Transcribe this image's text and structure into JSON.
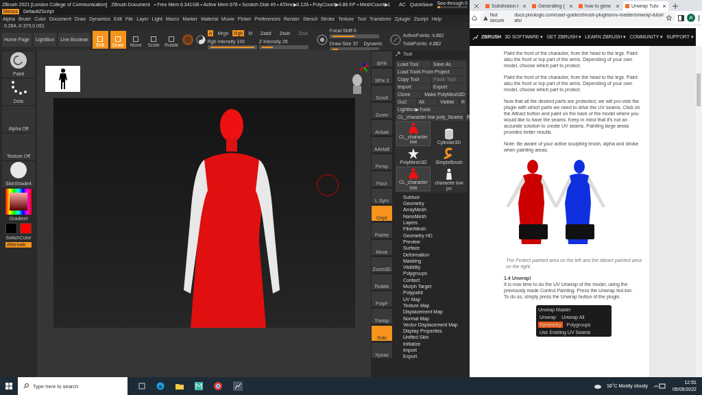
{
  "zbrush": {
    "title_bar": {
      "app": "ZBrush 2021 [London College of Communication]",
      "document": "ZBrush Document",
      "stats": "• Free Mem 6.341GB • Active Mem 676 • Scratch Disk 49 • ATime▶0.126 • PolyCount▶4.86 KP • MeshCount▶1",
      "ac": "AC",
      "quicksave": "QuickSave",
      "see_through": {
        "label": "See-through 0",
        "level": 0
      },
      "menus": {
        "label": "Menus",
        "on": true
      },
      "script": "DefaultZScript"
    },
    "menu": [
      "Alpha",
      "Brush",
      "Color",
      "Document",
      "Draw",
      "Dynamics",
      "Edit",
      "File",
      "Layer",
      "Light",
      "Macro",
      "Marker",
      "Material",
      "Movie",
      "Picker",
      "Preferences",
      "Render",
      "Stencil",
      "Stroke",
      "Texture",
      "Tool",
      "Transform",
      "Zplugin",
      "Zscript",
      "Help"
    ],
    "coordinates": "0.284,-0.379,0.051",
    "toolbar": {
      "buttons": [
        "Home Page",
        "LightBox",
        "Live Boolean"
      ],
      "modes": [
        {
          "label": "Edit",
          "selected": true
        },
        {
          "label": "Draw",
          "selected": true
        },
        {
          "label": "Move",
          "selected": false
        },
        {
          "label": "Scale",
          "selected": false
        },
        {
          "label": "Rotate",
          "selected": false
        }
      ],
      "channels": [
        {
          "label": "A",
          "selected": true
        },
        {
          "label": "Mrgb",
          "selected": false
        },
        {
          "label": "Rgb",
          "selected": true
        },
        {
          "label": "M",
          "selected": false
        }
      ],
      "sculpt": [
        {
          "label": "Zadd",
          "disabled": false
        },
        {
          "label": "Zsub",
          "disabled": false
        },
        {
          "label": "Zcut",
          "disabled": true
        }
      ],
      "sliders": [
        {
          "label": "Rgb Intensity 100",
          "level": 1.0
        },
        {
          "label": "Z Intensity 25",
          "level": 0.25
        },
        {
          "label": "Focal Shift 0",
          "level": 0.5
        },
        {
          "label": "Draw Size 37",
          "level": 0.12
        }
      ],
      "dynamic": "Dynamic",
      "points": [
        "ActivePoints: 4,882",
        "TotalPoints: 4,882"
      ]
    },
    "left_shelf": [
      {
        "label": "Paint",
        "kind": "brush"
      },
      {
        "label": "Dots",
        "kind": "stroke"
      },
      {
        "label": "Alpha Off",
        "kind": "empty"
      },
      {
        "label": "Texture Off",
        "kind": "empty"
      },
      {
        "label": "SkinShade4",
        "kind": "material"
      }
    ],
    "gradient": "Gradient",
    "switch_color": "SwitchColor",
    "alternate": {
      "label": "Alternate",
      "on": true
    },
    "right_shelf": [
      {
        "label": "BPR",
        "on": false
      },
      {
        "label": "SPix 3",
        "on": false
      },
      {
        "label": "Scroll",
        "on": false
      },
      {
        "label": "Zoom",
        "on": false
      },
      {
        "label": "Actual",
        "on": false
      },
      {
        "label": "AAHalf",
        "on": false
      },
      {
        "label": "Persp",
        "on": false
      },
      {
        "label": "Floor",
        "on": false
      },
      {
        "label": "L.Sym",
        "on": false
      },
      {
        "label": "Gxyz",
        "on": true
      },
      {
        "label": "Frame",
        "on": false
      },
      {
        "label": "Move",
        "on": false
      },
      {
        "label": "Zoom3D",
        "on": false
      },
      {
        "label": "Rotate",
        "on": false
      },
      {
        "label": "PolyF",
        "on": false
      },
      {
        "label": "Transp",
        "on": false
      },
      {
        "label": "Solo",
        "on": true
      },
      {
        "label": "Xpose",
        "on": false
      }
    ],
    "tool_panel": {
      "title": "Tool",
      "button_rows": [
        [
          {
            "label": "Load Tool",
            "disabled": false
          },
          {
            "label": "Save As",
            "disabled": false
          }
        ],
        [
          {
            "label": "Load Tools From Project",
            "disabled": false
          }
        ],
        [
          {
            "label": "Copy Tool",
            "disabled": false
          },
          {
            "label": "Paste Tool",
            "disabled": true
          }
        ],
        [
          {
            "label": "Import",
            "disabled": false
          },
          {
            "label": "Export",
            "disabled": false
          }
        ],
        [
          {
            "label": "Clone",
            "disabled": false
          },
          {
            "label": "Make PolyMesh3D",
            "disabled": false
          }
        ],
        [
          {
            "label": "GoZ",
            "disabled": false
          },
          {
            "label": "All",
            "disabled": false
          },
          {
            "label": "Visible",
            "disabled": false
          },
          {
            "label": "R",
            "disabled": false
          }
        ],
        [
          {
            "label": "Lightbox▶Tools",
            "disabled": false
          }
        ],
        [
          {
            "label": "CL_character low poly_Seams",
            "disabled": false
          },
          {
            "label": "R",
            "disabled": false
          }
        ]
      ],
      "thumbnails": [
        {
          "label": "CL_character low",
          "kind": "figure",
          "selected": true
        },
        {
          "label": "Cylinder3D",
          "kind": "cylinder",
          "selected": false
        },
        {
          "label": "PolyMesh3D",
          "kind": "star",
          "selected": false
        },
        {
          "label": "SimpleBrush",
          "kind": "letter",
          "selected": false
        },
        {
          "label": "CL_character low",
          "kind": "figure",
          "selected": true
        },
        {
          "label": "character low po",
          "kind": "white-figure",
          "selected": false
        }
      ]
    },
    "subpalettes": [
      "Subtool",
      "Geometry",
      "ArrayMesh",
      "NanoMesh",
      "Layers",
      "FiberMesh",
      "Geometry HD",
      "Preview",
      "Surface",
      "Deformation",
      "Masking",
      "Visibility",
      "Polygroups",
      "Contact",
      "Morph Target",
      "Polypaint",
      "UV Map",
      "Texture Map",
      "Displacement Map",
      "Normal Map",
      "Vector Displacement Map",
      "Display Properties",
      "Unified Skin",
      "Initialize",
      "Import",
      "Export"
    ]
  },
  "browser": {
    "tabs": [
      {
        "title": "Subdivision l",
        "selected": false
      },
      {
        "title": "Generating (",
        "selected": false
      },
      {
        "title": "how to gene",
        "selected": false
      },
      {
        "title": "Unwrap Tuto",
        "selected": true
      }
    ],
    "security": "Not secure",
    "url": "docs.pixologic.com/user-guide/zbrush-plugins/uv-master/unwrap-tutorials/",
    "profile": "A",
    "site_logo": "ZBRUSH",
    "nav": [
      "3D SOFTWARE ▾",
      "GET ZBRUSH ▾",
      "LEARN ZBRUSH ▾",
      "COMMUNITY ▾",
      "SUPPORT ▾"
    ],
    "article": [
      {
        "kind": "p",
        "text": "Paint the front of the character, from the head to the legs. Paint also the front or top part of the arms. Depending of your own model, choose which part to protect."
      },
      {
        "kind": "p",
        "text": "Paint the front of the character, from the head to the legs. Paint also the front or top part of the arms. Depending of your own model, choose which part to protect."
      },
      {
        "kind": "p",
        "text": "Now that all the desired parts are protected, we will pro-vide the plugin with which parts we need to drive the UV seams. Click on the Attract button and paint on the back of the model where you would like to have the seams. Keep in mind that it’s not an accurate solution to create UV seams. Painting large areas provides better results."
      },
      {
        "kind": "p",
        "text": "Note: Be aware of your active sculpting brush, alpha and stroke when painting areas."
      },
      {
        "kind": "figure"
      },
      {
        "kind": "caption",
        "text": "The Protect painted area on the left and the Attract painted area on the right."
      },
      {
        "kind": "heading",
        "text": "1.4 Unwrap!"
      },
      {
        "kind": "tight",
        "text": "It is now time to do the UV Unwrap of the model, using the previously made Control Painting. Press the Unwrap but-ton."
      },
      {
        "kind": "p",
        "text": "To do so, simply press the Unwrap button of the plugin."
      },
      {
        "kind": "panel",
        "title": "Unwrap Master",
        "buttons": [
          {
            "label": "Unwrap",
            "on": false
          },
          {
            "label": "Unwrap All",
            "on": false
          },
          {
            "label": "Symmetry",
            "on": true
          },
          {
            "label": "Polygroups",
            "on": false
          },
          {
            "label": "Use Existing UV Seams",
            "on": false
          }
        ]
      }
    ]
  },
  "taskbar": {
    "search": {
      "placeholder": "Type here to search"
    },
    "weather": "16°C  Mostly cloudy",
    "time": "12:51",
    "date": "05/05/2022"
  }
}
